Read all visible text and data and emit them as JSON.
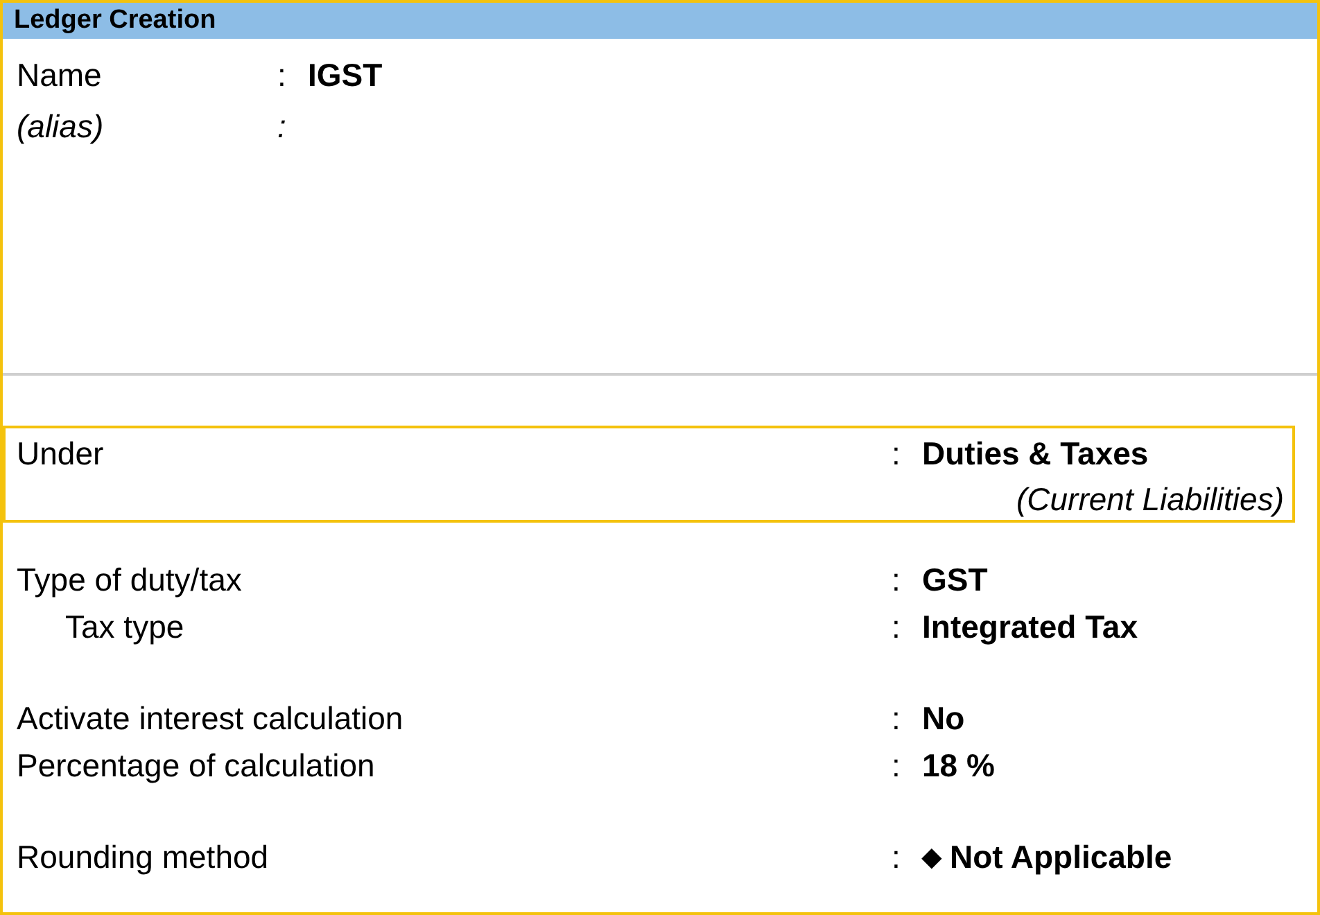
{
  "window": {
    "title": "Ledger Creation"
  },
  "name_fields": [
    {
      "kind": "name",
      "label": "Name",
      "separator": ":",
      "value": "IGST"
    },
    {
      "kind": "alias",
      "label": "(alias)",
      "separator": ":"
    }
  ],
  "under": {
    "label": "Under",
    "separator": ":",
    "value": "Duties & Taxes",
    "parent": "(Current Liabilities)",
    "focused": true
  },
  "groups": [
    [
      {
        "label": "Type of duty/tax",
        "separator": ":",
        "value": "GST",
        "children": [
          {
            "label": "Tax type",
            "separator": ":",
            "value": "Integrated Tax"
          }
        ]
      }
    ],
    [
      {
        "label": "Activate interest calculation",
        "separator": ":",
        "value": "No"
      },
      {
        "label": "Percentage of calculation",
        "separator": ":",
        "value": "18 %"
      }
    ],
    [
      {
        "label": "Rounding method",
        "separator": ":",
        "marker": "◆",
        "value": "Not Applicable"
      }
    ]
  ]
}
